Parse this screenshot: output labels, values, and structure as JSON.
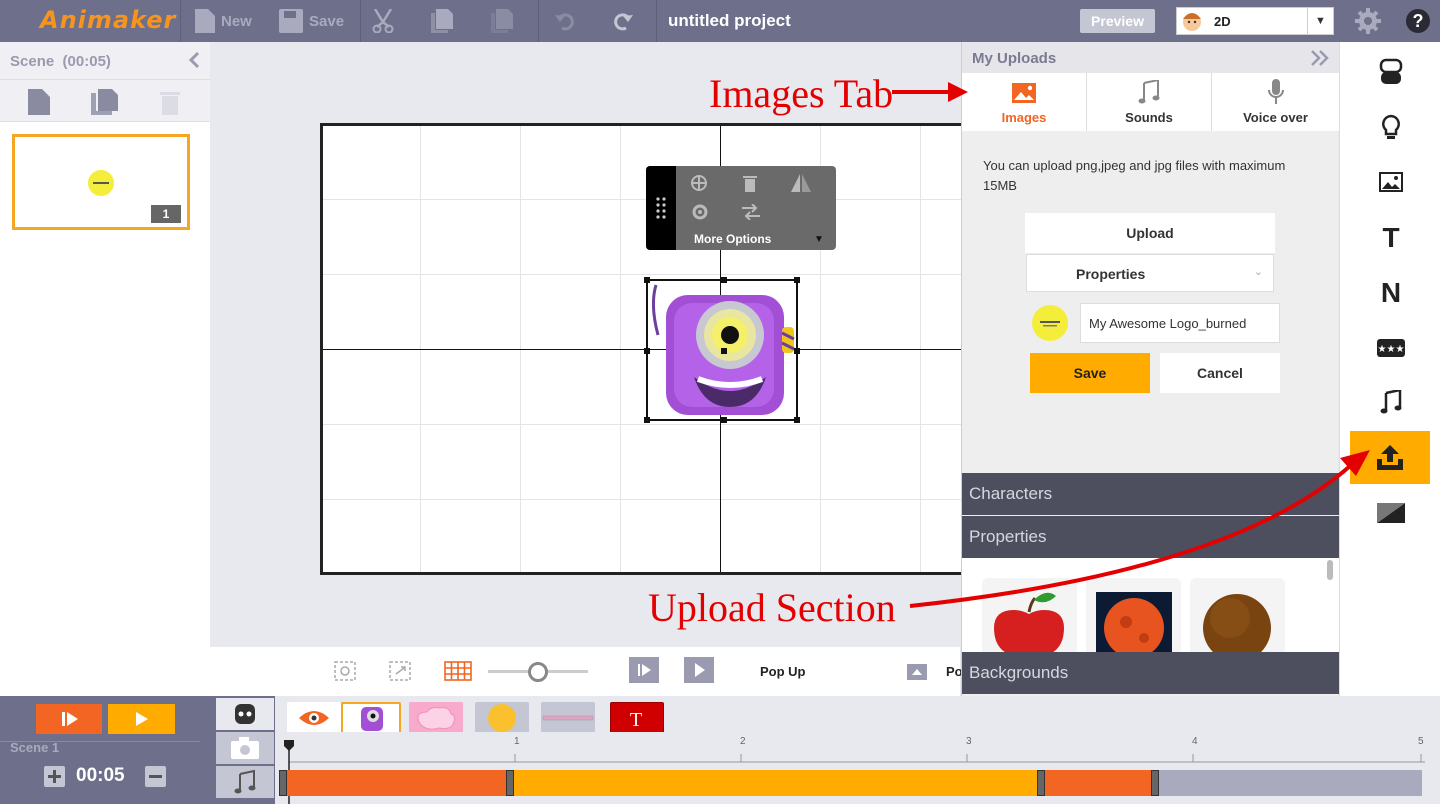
{
  "app": {
    "logo": "Animaker",
    "project_title": "untitled project"
  },
  "toolbar": {
    "new_label": "New",
    "save_label": "Save",
    "preview_label": "Preview",
    "mode_value": "2D"
  },
  "scene_panel": {
    "header": "Scene",
    "duration": "(00:05)",
    "thumb_number": "1"
  },
  "context_menu": {
    "more_options": "More Options"
  },
  "canvas_controls": {
    "animation_label": "Pop Up",
    "partial_label": "Po"
  },
  "uploads": {
    "title": "My Uploads",
    "tabs": [
      {
        "label": "Images",
        "active": true
      },
      {
        "label": "Sounds",
        "active": false
      },
      {
        "label": "Voice over",
        "active": false
      }
    ],
    "info": "You can upload png,jpeg and jpg files with maximum 15MB",
    "upload_button": "Upload",
    "properties_dropdown": "Properties",
    "file_name": "My Awesome Logo_burned",
    "save_button": "Save",
    "cancel_button": "Cancel",
    "sections": {
      "characters": "Characters",
      "properties": "Properties",
      "backgrounds": "Backgrounds"
    }
  },
  "timeline": {
    "scene_label": "Scene 1",
    "duration": "00:05",
    "ruler": [
      "1",
      "2",
      "3",
      "4",
      "5"
    ]
  },
  "annotations": {
    "images_tab": "Images Tab",
    "upload_section": "Upload Section"
  },
  "colors": {
    "accent_orange": "#f7941d",
    "save_yellow": "#ffab00",
    "topbar": "#6d6f8b",
    "annotation_red": "#e30000"
  }
}
